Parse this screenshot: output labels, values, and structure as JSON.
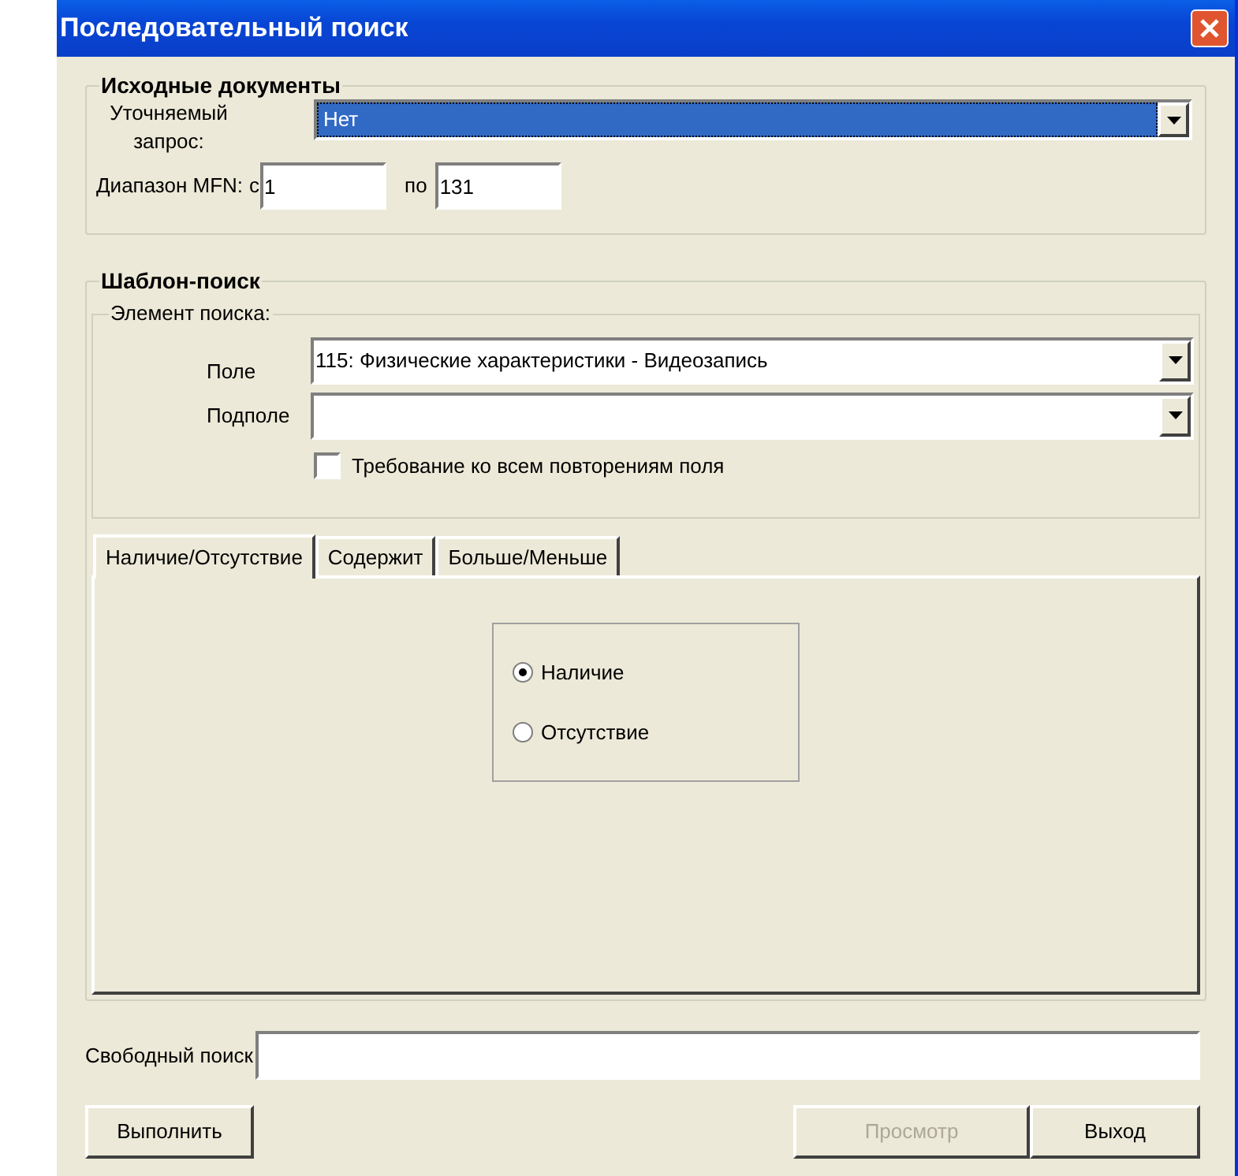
{
  "window": {
    "title": "Последовательный поиск"
  },
  "source_documents": {
    "title": "Исходные документы",
    "query_label": "Уточняемый запрос:",
    "query_value": "Нет",
    "range_label": "Диапазон MFN:",
    "from_label": "с",
    "from_value": "1",
    "to_label": "по",
    "to_value": "131"
  },
  "template_search": {
    "title": "Шаблон-поиск",
    "element_title": "Элемент поиска:",
    "field_label": "Поле",
    "field_value": "115: Физические характеристики - Видеозапись",
    "subfield_label": "Подполе",
    "require_all": {
      "label": "Требование ко всем повторениям поля",
      "checked": false
    },
    "tabs": [
      {
        "label": "Наличие/Отсутствие",
        "selected": true
      },
      {
        "label": "Содержит",
        "selected": false
      },
      {
        "label": "Больше/Меньше",
        "selected": false
      }
    ],
    "radios": [
      {
        "label": "Наличие",
        "selected": true
      },
      {
        "label": "Отсутствие",
        "selected": false
      }
    ]
  },
  "free_search": {
    "label": "Свободный поиск"
  },
  "buttons": [
    {
      "label": "Выполнить",
      "disabled": false
    },
    {
      "label": "Просмотр",
      "disabled": true
    },
    {
      "label": "Выход",
      "disabled": false
    }
  ]
}
